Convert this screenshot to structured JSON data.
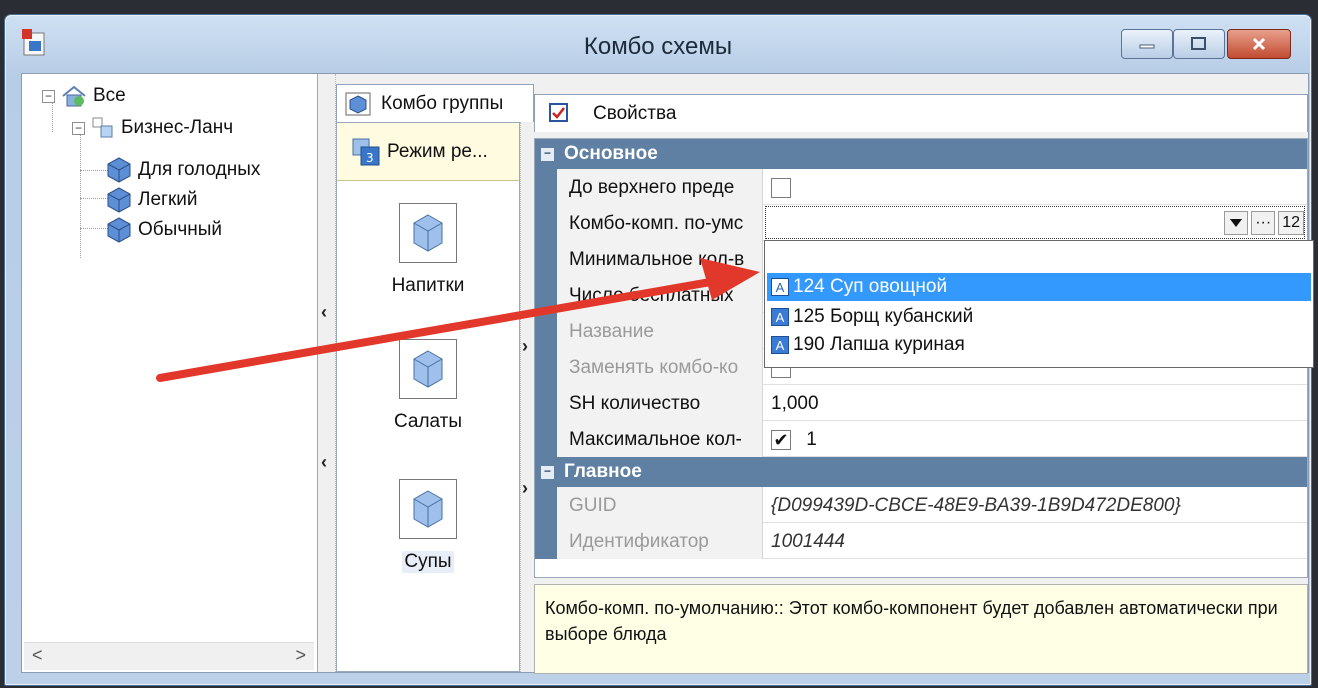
{
  "window": {
    "title": "Комбо схемы"
  },
  "tree": {
    "root": "Все",
    "scheme": "Бизнес-Ланч",
    "items": [
      "Для голодных",
      "Легкий",
      "Обычный"
    ]
  },
  "tabs": {
    "combo_groups": "Комбо группы",
    "properties": "Свойства"
  },
  "mode": {
    "label": "Режим ре...",
    "badge": "3"
  },
  "groups": [
    "Напитки",
    "Салаты",
    "Супы"
  ],
  "grid": {
    "category_main": "Основное",
    "category_general": "Главное",
    "rows": [
      {
        "name": "До верхнего преде",
        "value": ""
      },
      {
        "name": "Комбо-комп. по-умс",
        "value": ""
      },
      {
        "name": "Минимальное кол-в",
        "value": ""
      },
      {
        "name": "Число бесплатных",
        "value": ""
      },
      {
        "name": "Название",
        "value": ""
      },
      {
        "name": "Заменять комбо-ко",
        "value": ""
      },
      {
        "name": "SH количество",
        "value": "1,000"
      },
      {
        "name": "Максимальное кол-",
        "value": "1"
      }
    ],
    "guid_label": "GUID",
    "guid_value": "{D099439D-CBCE-48E9-BA39-1B9D472DE800}",
    "id_label": "Идентификатор",
    "id_value": "1001444",
    "combo_buttons": {
      "ellipsis": "···",
      "number": "12"
    }
  },
  "dropdown": {
    "items": [
      {
        "label": "124 Суп овощной",
        "selected": true
      },
      {
        "label": "125 Борщ кубанский",
        "selected": false
      },
      {
        "label": "190 Лапша куриная",
        "selected": false
      }
    ],
    "item_icon_letter": "A"
  },
  "help": {
    "text": "Комбо-комп. по-умолчанию:: Этот комбо-компонент будет добавлен автоматически при выборе блюда"
  },
  "colors": {
    "category_bar": "#5f7fa3",
    "selection": "#3399ff",
    "annotation_arrow": "#e2382b",
    "help_bg": "#ffffe6"
  }
}
